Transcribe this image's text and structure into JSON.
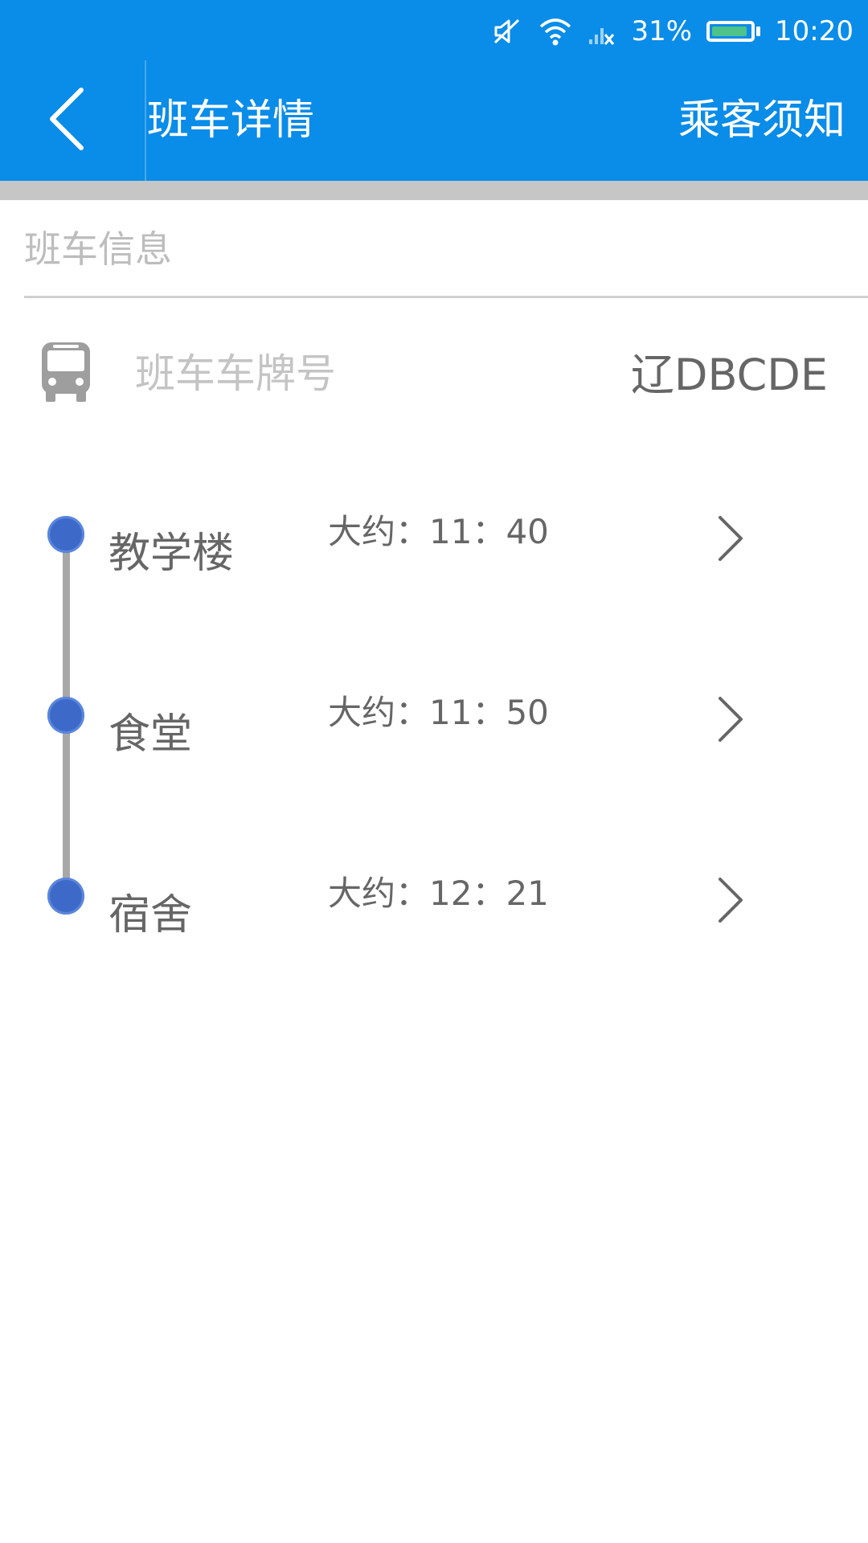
{
  "status_bar": {
    "battery": "31%",
    "time": "10:20",
    "battery_level": 0.31,
    "icons": [
      "mute-icon",
      "wifi-icon",
      "signal-no-service-icon",
      "battery-icon"
    ]
  },
  "toolbar": {
    "title": "班车详情",
    "notice_label": "乘客须知",
    "back_icon": "back-chevron-icon"
  },
  "section": {
    "title": "班车信息"
  },
  "plate": {
    "label": "班车车牌号",
    "value": "辽DBCDE",
    "icon": "bus-icon"
  },
  "stops": [
    {
      "name": "教学楼",
      "time": "大约：11：40"
    },
    {
      "name": "食堂",
      "time": "大约：11：50"
    },
    {
      "name": "宿舍",
      "time": "大约：12：21"
    }
  ],
  "colors": {
    "primary": "#0a8ce9",
    "dot": "#3d6ac9",
    "timeline": "#a8a8a8",
    "battery_fill": "#4dc38a"
  }
}
